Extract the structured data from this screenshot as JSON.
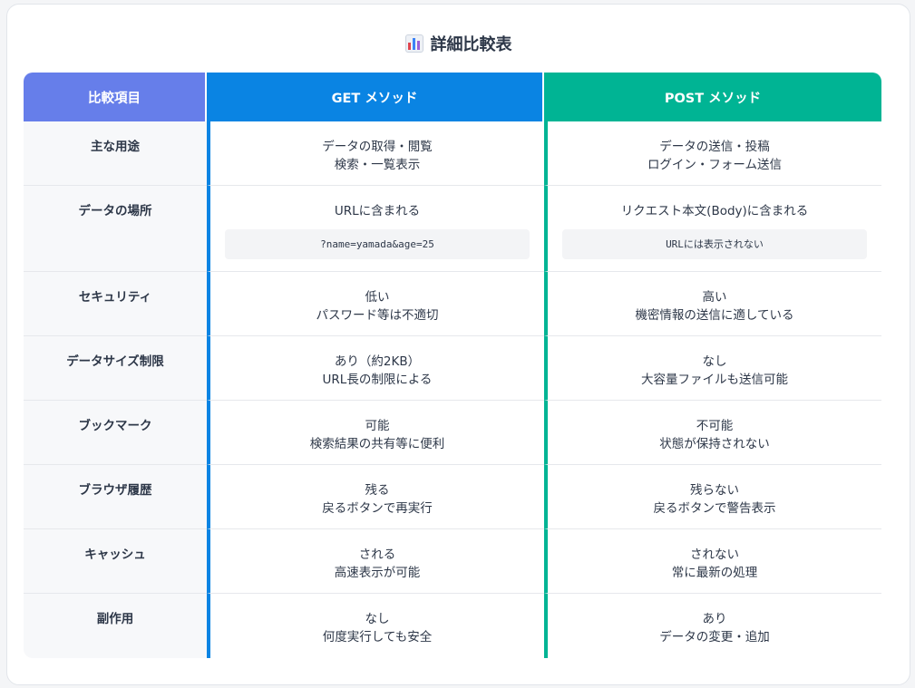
{
  "title": "詳細比較表",
  "title_icon": "bar-chart-icon",
  "colors": {
    "header_item": "#667eea",
    "get": "#0a84e3",
    "post": "#00b494"
  },
  "headers": {
    "item": "比較項目",
    "get": "GET メソッド",
    "post": "POST メソッド"
  },
  "rows": [
    {
      "item": "主な用途",
      "get": [
        "データの取得・閲覧",
        "検索・一覧表示"
      ],
      "post": [
        "データの送信・投稿",
        "ログイン・フォーム送信"
      ]
    },
    {
      "item": "データの場所",
      "get": [
        "URLに含まれる"
      ],
      "get_code": "?name=yamada&age=25",
      "post": [
        "リクエスト本文(Body)に含まれる"
      ],
      "post_code": "URLには表示されない"
    },
    {
      "item": "セキュリティ",
      "get": [
        "低い",
        "パスワード等は不適切"
      ],
      "post": [
        "高い",
        "機密情報の送信に適している"
      ]
    },
    {
      "item": "データサイズ制限",
      "get": [
        "あり（約2KB）",
        "URL長の制限による"
      ],
      "post": [
        "なし",
        "大容量ファイルも送信可能"
      ]
    },
    {
      "item": "ブックマーク",
      "get": [
        "可能",
        "検索結果の共有等に便利"
      ],
      "post": [
        "不可能",
        "状態が保持されない"
      ]
    },
    {
      "item": "ブラウザ履歴",
      "get": [
        "残る",
        "戻るボタンで再実行"
      ],
      "post": [
        "残らない",
        "戻るボタンで警告表示"
      ]
    },
    {
      "item": "キャッシュ",
      "get": [
        "される",
        "高速表示が可能"
      ],
      "post": [
        "されない",
        "常に最新の処理"
      ]
    },
    {
      "item": "副作用",
      "get": [
        "なし",
        "何度実行しても安全"
      ],
      "post": [
        "あり",
        "データの変更・追加"
      ]
    }
  ]
}
